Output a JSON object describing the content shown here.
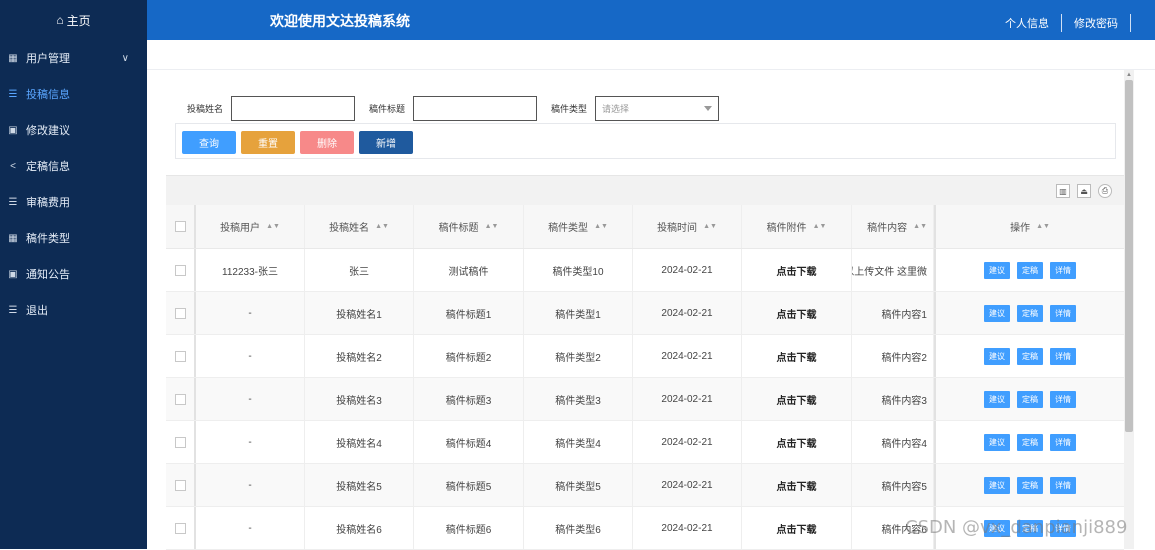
{
  "sidebar": {
    "home": "主页",
    "items": [
      {
        "label": "用户管理",
        "icon": "grid-icon"
      },
      {
        "label": "投稿信息",
        "icon": "list-icon"
      },
      {
        "label": "修改建议",
        "icon": "save-icon"
      },
      {
        "label": "定稿信息",
        "icon": "share-icon"
      },
      {
        "label": "审稿费用",
        "icon": "list-icon"
      },
      {
        "label": "稿件类型",
        "icon": "grid-icon"
      },
      {
        "label": "通知公告",
        "icon": "save-icon"
      },
      {
        "label": "退出",
        "icon": "list-icon"
      }
    ],
    "active_color": "#5aa6ff",
    "bg": "#0d2b54"
  },
  "header": {
    "title": "欢迎使用文达投稿系统",
    "profile_link": "个人信息",
    "password_link": "修改密码",
    "bg": "#1668c6"
  },
  "search": {
    "name_label": "投稿姓名",
    "title_label": "稿件标题",
    "type_label": "稿件类型",
    "type_placeholder": "请选择"
  },
  "buttons": {
    "query": "查询",
    "reset": "重置",
    "delete": "删除",
    "add": "新增"
  },
  "table": {
    "headers": [
      "投稿用户",
      "投稿姓名",
      "稿件标题",
      "稿件类型",
      "投稿时间",
      "稿件附件",
      "稿件内容",
      "操作"
    ],
    "rows": [
      [
        "112233-张三",
        "张三",
        "测试稿件",
        "稿件类型10",
        "2024-02-21",
        "点击下载",
        "可以上传文件 这里微"
      ],
      [
        "-",
        "投稿姓名1",
        "稿件标题1",
        "稿件类型1",
        "2024-02-21",
        "点击下载",
        "稿件内容1"
      ],
      [
        "-",
        "投稿姓名2",
        "稿件标题2",
        "稿件类型2",
        "2024-02-21",
        "点击下载",
        "稿件内容2"
      ],
      [
        "-",
        "投稿姓名3",
        "稿件标题3",
        "稿件类型3",
        "2024-02-21",
        "点击下载",
        "稿件内容3"
      ],
      [
        "-",
        "投稿姓名4",
        "稿件标题4",
        "稿件类型4",
        "2024-02-21",
        "点击下载",
        "稿件内容4"
      ],
      [
        "-",
        "投稿姓名5",
        "稿件标题5",
        "稿件类型5",
        "2024-02-21",
        "点击下载",
        "稿件内容5"
      ],
      [
        "-",
        "投稿姓名6",
        "稿件标题6",
        "稿件类型6",
        "2024-02-21",
        "点击下载",
        "稿件内容6"
      ]
    ],
    "row_actions": [
      "建议",
      "定稿",
      "详情"
    ]
  },
  "watermark": "CSDN @vx_danpianji889"
}
